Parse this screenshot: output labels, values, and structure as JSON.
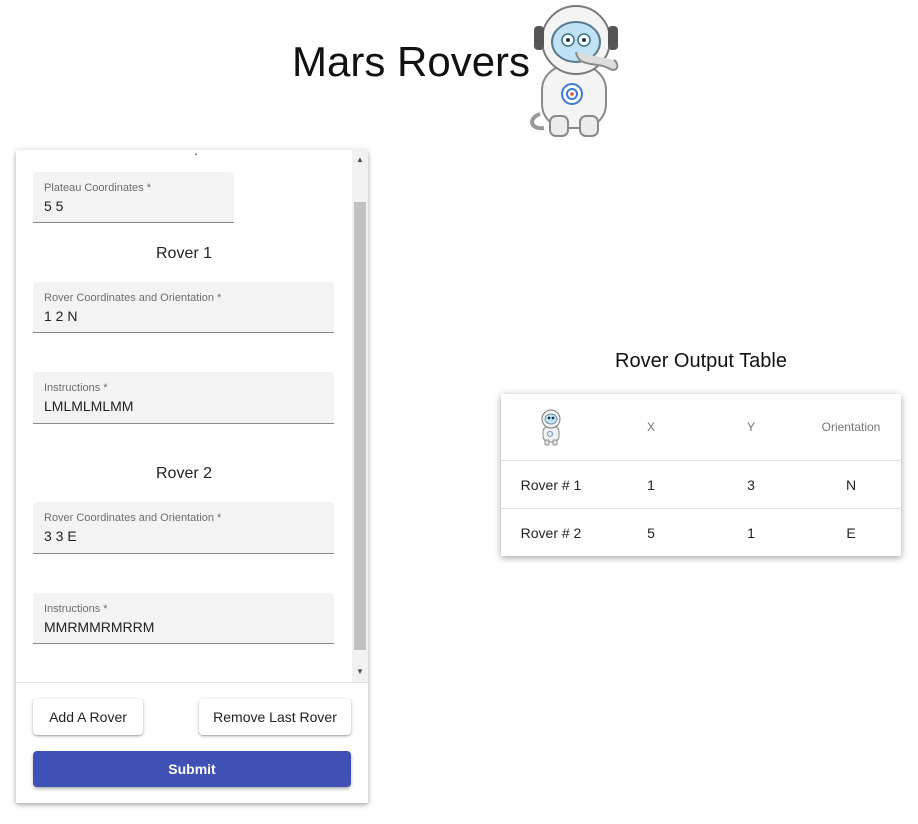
{
  "header": {
    "title": "Mars Rovers"
  },
  "form": {
    "plateau": {
      "label": "Plateau Coordinates *",
      "value": "5 5"
    },
    "rovers": [
      {
        "heading": "Rover 1",
        "coords_label": "Rover Coordinates and Orientation *",
        "coords_value": "1 2 N",
        "instr_label": "Instructions *",
        "instr_value": "LMLMLMLMM"
      },
      {
        "heading": "Rover 2",
        "coords_label": "Rover Coordinates and Orientation *",
        "coords_value": "3 3 E",
        "instr_label": "Instructions *",
        "instr_value": "MMRMMRMRRM"
      }
    ],
    "add_button": "Add A Rover",
    "remove_button": "Remove Last Rover",
    "submit_button": "Submit"
  },
  "output": {
    "title": "Rover Output Table",
    "columns": [
      "X",
      "Y",
      "Orientation"
    ],
    "rows": [
      {
        "name": "Rover # 1",
        "x": "1",
        "y": "3",
        "orientation": "N"
      },
      {
        "name": "Rover # 2",
        "x": "5",
        "y": "1",
        "orientation": "E"
      }
    ]
  },
  "colors": {
    "primary": "#3f51b5",
    "field_bg": "#f3f3f3",
    "scroll_thumb": "#c1c1c1"
  }
}
